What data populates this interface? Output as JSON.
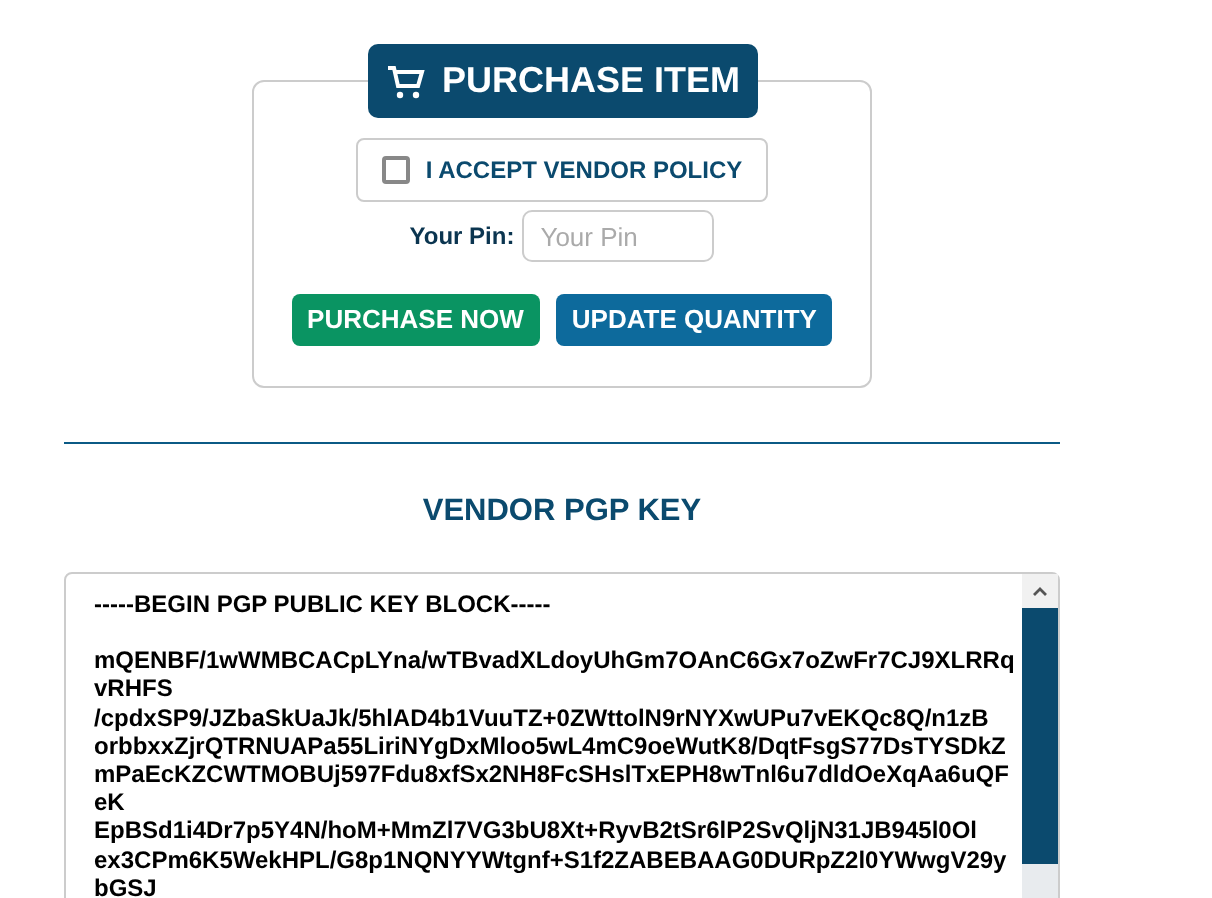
{
  "purchase": {
    "title": "PURCHASE ITEM",
    "policy": {
      "label": "I ACCEPT VENDOR POLICY",
      "checked": false
    },
    "pin": {
      "label": "Your Pin:",
      "placeholder": "Your Pin"
    },
    "buttons": [
      {
        "label": "PURCHASE NOW",
        "kind": "success"
      },
      {
        "label": "UPDATE QUANTITY",
        "kind": "primary"
      }
    ]
  },
  "pgp": {
    "heading": "VENDOR PGP KEY",
    "header": "-----BEGIN PGP PUBLIC KEY BLOCK-----",
    "lines": [
      "mQENBF/1wWMBCACpLYna/wTBvadXLdoyUhGm7OAnC6Gx7oZwFr7CJ9XLRRq",
      "vRHFS",
      "/cpdxSP9/JZbaSkUaJk/5hlAD4b1VuuTZ+0ZWttolN9rNYXwUPu7vEKQc8Q/n1zB",
      "orbbxxZjrQTRNUAPa55LiriNYgDxMloo5wL4mC9oeWutK8/DqtFsgS77DsTYSDkZ",
      "mPaEcKZCWTMOBUj597Fdu8xfSx2NH8FcSHslTxEPH8wTnl6u7dldOeXqAa6uQF",
      "eK",
      "EpBSd1i4Dr7p5Y4N/hoM+MmZl7VG3bU8Xt+RyvB2tSr6lP2SvQljN31JB945l0Ol",
      "ex3CPm6K5WekHPL/G8p1NQNYYWtgnf+S1f2ZABEBAAG0DURpZ2l0YWwgV29y",
      "bGSJ"
    ]
  }
}
